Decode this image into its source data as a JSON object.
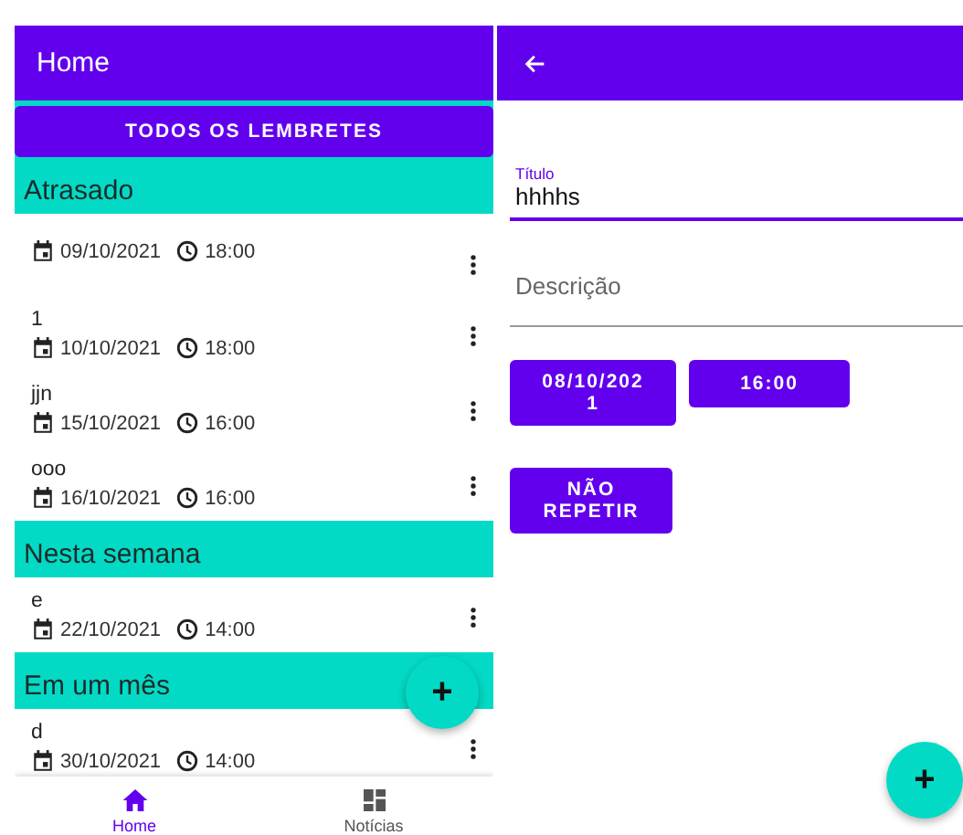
{
  "list_screen": {
    "title": "Home",
    "all_button": "TODOS OS LEMBRETES",
    "sections": [
      {
        "heading": "Atrasado",
        "items": [
          {
            "date": "09/10/2021",
            "time": "18:00"
          },
          {
            "title": "1",
            "date": "10/10/2021",
            "time": "18:00"
          },
          {
            "title": "jjn",
            "date": "15/10/2021",
            "time": "16:00"
          },
          {
            "title": "ooo",
            "date": "16/10/2021",
            "time": "16:00"
          }
        ]
      },
      {
        "heading": "Nesta semana",
        "items": [
          {
            "title": "e",
            "date": "22/10/2021",
            "time": "14:00"
          }
        ]
      },
      {
        "heading": "Em um mês",
        "items": [
          {
            "title": "d",
            "date": "30/10/2021",
            "time": "14:00"
          }
        ]
      }
    ],
    "fab": "+",
    "nav": [
      {
        "label": "Home",
        "kind": "home",
        "selected": true
      },
      {
        "label": "Notícias",
        "kind": "grid",
        "selected": false
      }
    ]
  },
  "edit_screen": {
    "fields": [
      {
        "label": "Título",
        "value": "hhhhs",
        "focused": true
      },
      {
        "placeholder": "Descrição",
        "focused": false
      }
    ],
    "date_button": "08/10/202\n1",
    "time_button": "16:00",
    "repeat_button": "NÃO\nREPETIR",
    "fab": "+"
  }
}
